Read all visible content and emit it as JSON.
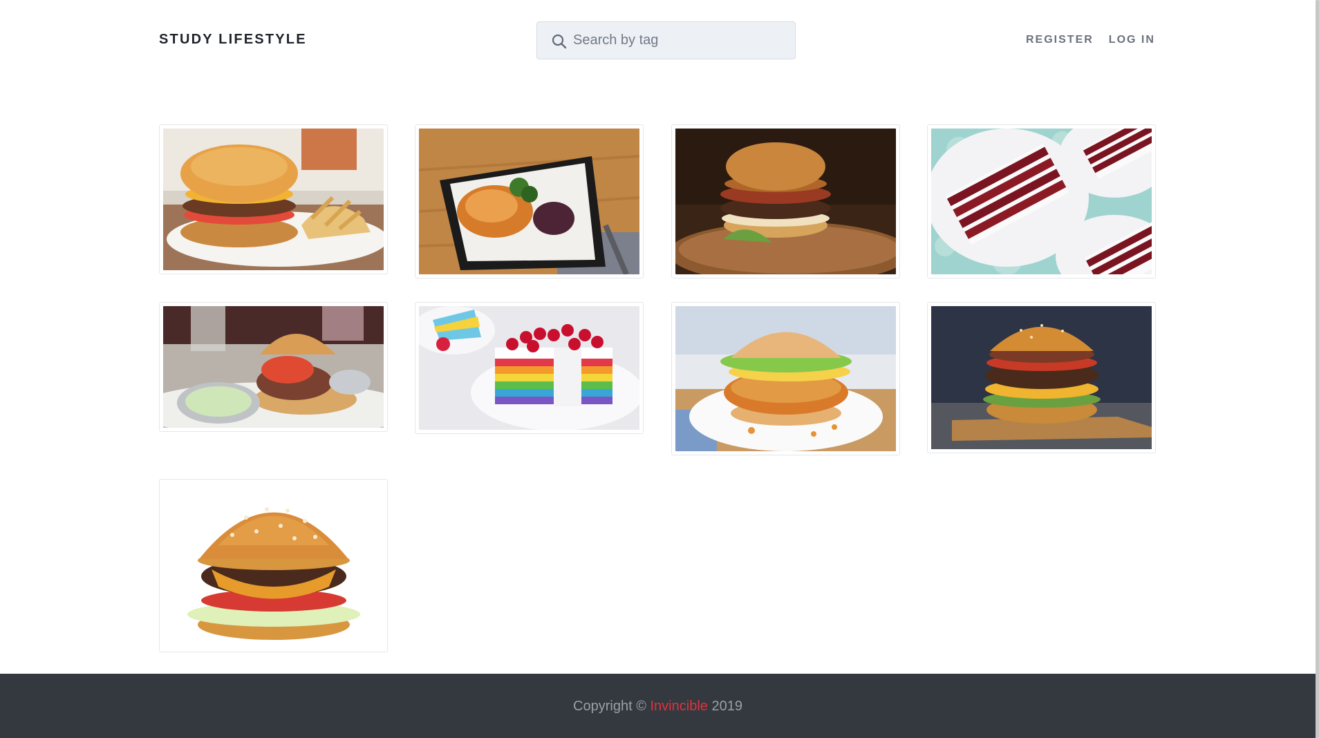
{
  "header": {
    "brand": "STUDY LIFESTYLE",
    "search_placeholder": "Search by tag",
    "nav": {
      "register": "REGISTER",
      "login": "LOG IN"
    }
  },
  "gallery": {
    "items": [
      {
        "subject": "bacon cheeseburger with fries"
      },
      {
        "subject": "roasted cauliflower steak plate"
      },
      {
        "subject": "bacon burger on wooden board"
      },
      {
        "subject": "red velvet cake slices"
      },
      {
        "subject": "burger with tomato and dipping sauce"
      },
      {
        "subject": "rainbow crepe cake with raspberries"
      },
      {
        "subject": "crispy chicken burger"
      },
      {
        "subject": "double cheeseburger on cutting board"
      },
      {
        "subject": "classic cheeseburger on white"
      }
    ]
  },
  "footer": {
    "copyright_prefix": "Copyright ©",
    "brand": "Invincible",
    "year": "2019"
  },
  "colors": {
    "brand_red": "#e0323c",
    "footer_bg": "#343940",
    "search_bg": "#edf1f6"
  }
}
